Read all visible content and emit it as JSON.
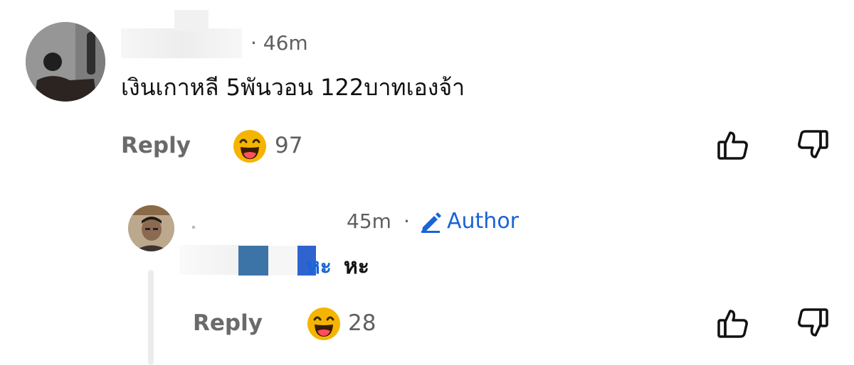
{
  "comments": [
    {
      "timestamp": "· 46m",
      "text": "เงินเกาหลี 5พันวอน 122บาทเองจ้า",
      "reply_label": "Reply",
      "reaction_count": "97"
    },
    {
      "timestamp": "45m",
      "separator": "·",
      "author_badge": "Author",
      "mention": "หะ",
      "text": "หะ",
      "reply_label": "Reply",
      "reaction_count": "28"
    }
  ],
  "icons": {
    "reaction": "laughing-emoji-icon",
    "like": "thumbs-up-icon",
    "dislike": "thumbs-down-icon",
    "author": "pencil-icon"
  },
  "colors": {
    "accent": "#1a63d8",
    "muted_text": "#6a6a6a",
    "emoji": "#f5b400"
  }
}
